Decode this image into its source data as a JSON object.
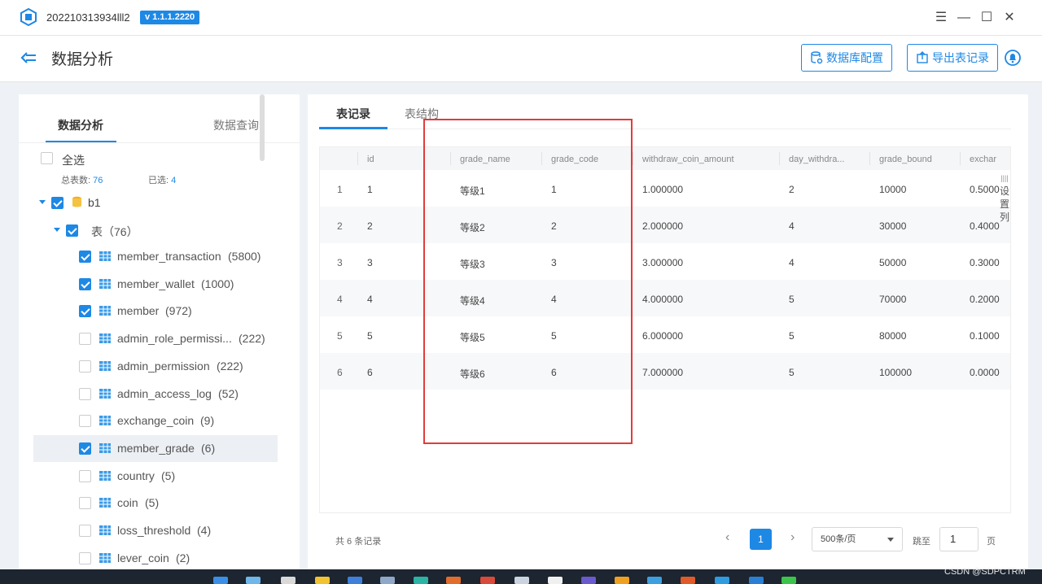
{
  "window": {
    "app_name": "202210313934lll2",
    "version": "v 1.1.1.2220",
    "menu_glyph": "☰",
    "minimize_glyph": "—",
    "maximize_glyph": "☐",
    "close_glyph": "✕"
  },
  "header": {
    "title": "数据分析",
    "db_config_label": "数据库配置",
    "export_label": "导出表记录"
  },
  "left": {
    "tab_analysis": "数据分析",
    "tab_query": "数据查询",
    "select_all": "全选",
    "total_label": "总表数:",
    "total_value": "76",
    "selected_label": "已选:",
    "selected_value": "4",
    "db_name": "b1",
    "table_group": "表（76）",
    "tables": [
      {
        "name": "member_transaction",
        "count": "(5800)",
        "checked": true
      },
      {
        "name": "member_wallet",
        "count": "(1000)",
        "checked": true
      },
      {
        "name": "member",
        "count": "(972)",
        "checked": true
      },
      {
        "name": "admin_role_permissi...",
        "count": "(222)",
        "checked": false
      },
      {
        "name": "admin_permission",
        "count": "(222)",
        "checked": false
      },
      {
        "name": "admin_access_log",
        "count": "(52)",
        "checked": false
      },
      {
        "name": "exchange_coin",
        "count": "(9)",
        "checked": false
      },
      {
        "name": "member_grade",
        "count": "(6)",
        "checked": true
      },
      {
        "name": "country",
        "count": "(5)",
        "checked": false
      },
      {
        "name": "coin",
        "count": "(5)",
        "checked": false
      },
      {
        "name": "loss_threshold",
        "count": "(4)",
        "checked": false
      },
      {
        "name": "lever_coin",
        "count": "(2)",
        "checked": false
      }
    ]
  },
  "main": {
    "tab_records": "表记录",
    "tab_structure": "表结构",
    "columns": [
      "",
      "id",
      "grade_name",
      "grade_code",
      "withdraw_coin_amount",
      "day_withdra...",
      "grade_bound",
      "exchar"
    ],
    "rows": [
      [
        "1",
        "1",
        "等级1",
        "1",
        "1.000000",
        "2",
        "10000",
        "0.5000"
      ],
      [
        "2",
        "2",
        "等级2",
        "2",
        "2.000000",
        "4",
        "30000",
        "0.4000"
      ],
      [
        "3",
        "3",
        "等级3",
        "3",
        "3.000000",
        "4",
        "50000",
        "0.3000"
      ],
      [
        "4",
        "4",
        "等级4",
        "4",
        "4.000000",
        "5",
        "70000",
        "0.2000"
      ],
      [
        "5",
        "5",
        "等级5",
        "5",
        "6.000000",
        "5",
        "80000",
        "0.1000"
      ],
      [
        "6",
        "6",
        "等级6",
        "6",
        "7.000000",
        "5",
        "100000",
        "0.0000"
      ]
    ],
    "settings_col": "设置列",
    "pagination": {
      "total_text": "共  6  条记录",
      "current_page": "1",
      "page_size": "500条/页",
      "jump_label": "跳至",
      "jump_value": "1",
      "page_unit": "页",
      "prev_glyph": "‹",
      "next_glyph": "›"
    }
  },
  "footer": {
    "watermark": "CSDN @SDPCTRM"
  },
  "colors": {
    "accent": "#1e88e5",
    "highlight_box": "#e23b3b"
  }
}
